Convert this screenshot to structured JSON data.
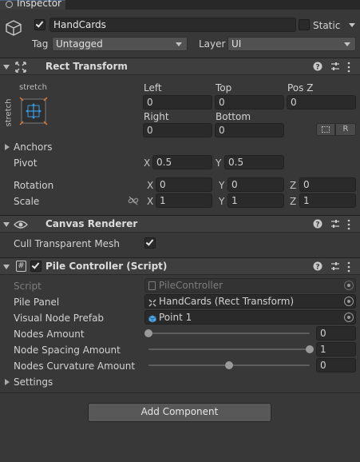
{
  "tab": {
    "title": "Inspector"
  },
  "gameobject": {
    "name": "HandCards",
    "static_label": "Static",
    "tag_label": "Tag",
    "tag_value": "Untagged",
    "layer_label": "Layer",
    "layer_value": "UI"
  },
  "rect_transform": {
    "title": "Rect Transform",
    "anchor_preset_top": "stretch",
    "anchor_preset_side": "stretch",
    "labels": {
      "left": "Left",
      "top": "Top",
      "posz": "Pos Z",
      "right": "Right",
      "bottom": "Bottom"
    },
    "values": {
      "left": "0",
      "top": "0",
      "posz": "0",
      "right": "0",
      "bottom": "0"
    },
    "raw_button": "R",
    "anchors_label": "Anchors",
    "pivot_label": "Pivot",
    "pivot": {
      "x": "0.5",
      "y": "0.5"
    },
    "rotation_label": "Rotation",
    "rotation": {
      "x": "0",
      "y": "0",
      "z": "0"
    },
    "scale_label": "Scale",
    "scale": {
      "x": "1",
      "y": "1",
      "z": "1"
    },
    "axis": {
      "x": "X",
      "y": "Y",
      "z": "Z"
    }
  },
  "canvas_renderer": {
    "title": "Canvas Renderer",
    "cull_label": "Cull Transparent Mesh",
    "cull_checked": true
  },
  "pile_controller": {
    "title": "Pile Controller (Script)",
    "script_label": "Script",
    "script_value": "PileController",
    "pile_panel_label": "Pile Panel",
    "pile_panel_value": "HandCards (Rect Transform)",
    "visual_node_label": "Visual Node Prefab",
    "visual_node_value": "Point 1",
    "nodes_amount_label": "Nodes Amount",
    "nodes_amount_value": "0",
    "nodes_amount_fraction": 0.0,
    "node_spacing_label": "Node Spacing Amount",
    "node_spacing_value": "1",
    "node_spacing_fraction": 1.0,
    "node_curvature_label": "Nodes Curvature Amount",
    "node_curvature_value": "0",
    "node_curvature_fraction": 0.5,
    "settings_label": "Settings"
  },
  "add_component": {
    "label": "Add Component"
  },
  "colors": {
    "background": "#383838",
    "field": "#2a2a2a",
    "header": "#3e3e3e",
    "text": "#d2d2d2",
    "anchor_blue": "#3a9be0",
    "anchor_orange": "#e0782e"
  },
  "icons": {
    "tab": "inspector-icon",
    "gameobject": "cube-icon",
    "rect_transform": "rect-transform-icon",
    "canvas_renderer": "eye-icon",
    "pile_controller": "script-hash-icon",
    "help": "help-icon",
    "presets": "presets-sliders-icon",
    "menu": "kebab-menu-icon",
    "prefab": "prefab-cube-icon"
  }
}
